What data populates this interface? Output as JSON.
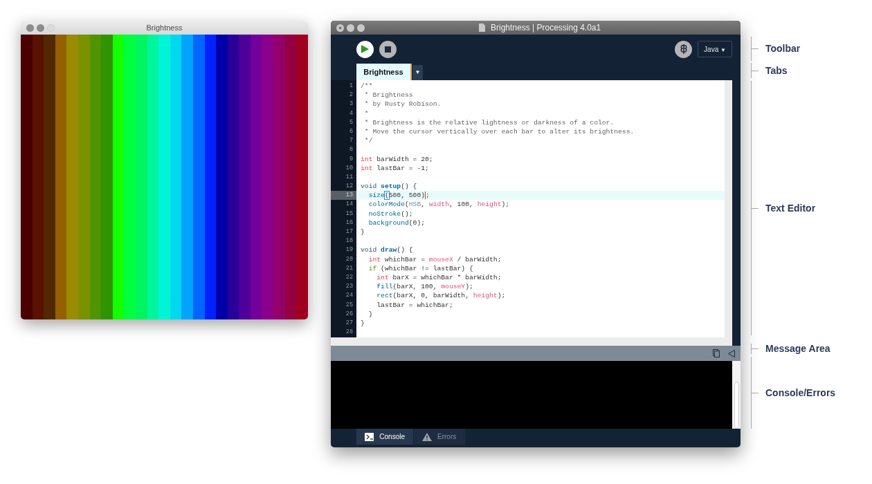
{
  "sketch_window": {
    "title": "Brightness",
    "bars": [
      {
        "color": "#4a0000"
      },
      {
        "color": "#571200"
      },
      {
        "color": "#522800"
      },
      {
        "color": "#946000"
      },
      {
        "color": "#998c00"
      },
      {
        "color": "#7a9100"
      },
      {
        "color": "#509400"
      },
      {
        "color": "#2f9400"
      },
      {
        "color": "#14ff00"
      },
      {
        "color": "#00ff40"
      },
      {
        "color": "#00f560"
      },
      {
        "color": "#00f5a0"
      },
      {
        "color": "#00f5d8"
      },
      {
        "color": "#00d8f0"
      },
      {
        "color": "#00a4ff"
      },
      {
        "color": "#0066ff"
      },
      {
        "color": "#0022ff"
      },
      {
        "color": "#0000a8"
      },
      {
        "color": "#2a0099"
      },
      {
        "color": "#4f0099"
      },
      {
        "color": "#72009a"
      },
      {
        "color": "#8a008a"
      },
      {
        "color": "#94006a"
      },
      {
        "color": "#940040"
      },
      {
        "color": "#a00020"
      }
    ]
  },
  "editor_window": {
    "title": "Brightness | Processing 4.0a1",
    "toolbar": {
      "mode_label": "Java",
      "mode_arrow": "▼"
    },
    "tabs": [
      {
        "label": "Brightness",
        "selected": true
      }
    ],
    "tab_menu": "▼",
    "lines": [
      {
        "number": "1",
        "selected": false,
        "tokens": [
          {
            "kind": "comment",
            "text": "/**"
          }
        ]
      },
      {
        "number": "2",
        "selected": false,
        "tokens": [
          {
            "kind": "comment",
            "text": " * Brightness"
          }
        ]
      },
      {
        "number": "3",
        "selected": false,
        "tokens": [
          {
            "kind": "comment",
            "text": " * by Rusty Robison."
          }
        ]
      },
      {
        "number": "4",
        "selected": false,
        "tokens": [
          {
            "kind": "comment",
            "text": " *"
          }
        ]
      },
      {
        "number": "5",
        "selected": false,
        "tokens": [
          {
            "kind": "comment",
            "text": " * Brightness is the relative lightness or darkness of a color."
          }
        ]
      },
      {
        "number": "6",
        "selected": false,
        "tokens": [
          {
            "kind": "comment",
            "text": " * Move the cursor vertically over each bar to alter its brightness."
          }
        ]
      },
      {
        "number": "7",
        "selected": false,
        "tokens": [
          {
            "kind": "comment",
            "text": " */"
          }
        ]
      },
      {
        "number": "8",
        "selected": false
      },
      {
        "number": "9",
        "selected": false,
        "tokens": [
          {
            "kind": "type",
            "text": "int"
          },
          {
            "kind": "plain",
            "text": " barWidth = 20;"
          }
        ]
      },
      {
        "number": "10",
        "selected": false,
        "tokens": [
          {
            "kind": "type",
            "text": "int"
          },
          {
            "kind": "plain",
            "text": " lastBar = -1;"
          }
        ]
      },
      {
        "number": "11",
        "selected": false
      },
      {
        "number": "12",
        "selected": false,
        "tokens": [
          {
            "kind": "keyword",
            "text": "void "
          },
          {
            "kind": "definition",
            "text": "setup"
          },
          {
            "kind": "plain",
            "text": "() {"
          }
        ]
      },
      {
        "number": "13",
        "selected": true,
        "tokens": [
          {
            "kind": "function",
            "text": "  size"
          },
          {
            "kind": "match",
            "text": "("
          },
          {
            "kind": "plain",
            "text": "500, 500)"
          },
          {
            "kind": "caret"
          },
          {
            "kind": "plain",
            "text": ";"
          }
        ]
      },
      {
        "number": "14",
        "selected": false,
        "tokens": [
          {
            "kind": "function",
            "text": "  colorMode"
          },
          {
            "kind": "plain",
            "text": "("
          },
          {
            "kind": "literal",
            "text": "HSB"
          },
          {
            "kind": "plain",
            "text": ", "
          },
          {
            "kind": "constant",
            "text": "width"
          },
          {
            "kind": "plain",
            "text": ", 100, "
          },
          {
            "kind": "constant",
            "text": "height"
          },
          {
            "kind": "plain",
            "text": ");"
          }
        ]
      },
      {
        "number": "15",
        "selected": false,
        "tokens": [
          {
            "kind": "function",
            "text": "  noStroke"
          },
          {
            "kind": "plain",
            "text": "();"
          }
        ]
      },
      {
        "number": "16",
        "selected": false,
        "tokens": [
          {
            "kind": "function",
            "text": "  background"
          },
          {
            "kind": "plain",
            "text": "(0);"
          }
        ]
      },
      {
        "number": "17",
        "selected": false,
        "tokens": [
          {
            "kind": "plain",
            "text": "}"
          }
        ]
      },
      {
        "number": "18",
        "selected": false
      },
      {
        "number": "19",
        "selected": false,
        "tokens": [
          {
            "kind": "keyword",
            "text": "void "
          },
          {
            "kind": "definition",
            "text": "draw"
          },
          {
            "kind": "plain",
            "text": "() {"
          }
        ]
      },
      {
        "number": "20",
        "selected": false,
        "tokens": [
          {
            "kind": "type",
            "text": "  int"
          },
          {
            "kind": "plain",
            "text": " whichBar = "
          },
          {
            "kind": "constant",
            "text": "mouseX"
          },
          {
            "kind": "plain",
            "text": " / barWidth;"
          }
        ]
      },
      {
        "number": "21",
        "selected": false,
        "tokens": [
          {
            "kind": "control",
            "text": "  if"
          },
          {
            "kind": "plain",
            "text": " (whichBar != lastBar) {"
          }
        ]
      },
      {
        "number": "22",
        "selected": false,
        "tokens": [
          {
            "kind": "type",
            "text": "    int"
          },
          {
            "kind": "plain",
            "text": " barX = whichBar * barWidth;"
          }
        ]
      },
      {
        "number": "23",
        "selected": false,
        "tokens": [
          {
            "kind": "function",
            "text": "    fill"
          },
          {
            "kind": "plain",
            "text": "(barX, 100, "
          },
          {
            "kind": "constant",
            "text": "mouseY"
          },
          {
            "kind": "plain",
            "text": ");"
          }
        ]
      },
      {
        "number": "24",
        "selected": false,
        "tokens": [
          {
            "kind": "function",
            "text": "    rect"
          },
          {
            "kind": "plain",
            "text": "(barX, 0, barWidth, "
          },
          {
            "kind": "constant",
            "text": "height"
          },
          {
            "kind": "plain",
            "text": ");"
          }
        ]
      },
      {
        "number": "25",
        "selected": false,
        "tokens": [
          {
            "kind": "plain",
            "text": "    lastBar = whichBar;"
          }
        ]
      },
      {
        "number": "26",
        "selected": false,
        "tokens": [
          {
            "kind": "plain",
            "text": "  }"
          }
        ]
      },
      {
        "number": "27",
        "selected": false,
        "tokens": [
          {
            "kind": "plain",
            "text": "}"
          }
        ]
      },
      {
        "number": "28",
        "selected": false
      }
    ],
    "console_tabs": [
      {
        "label": "Console",
        "kind": "console",
        "selected": true
      },
      {
        "label": "Errors",
        "kind": "errors",
        "selected": false
      }
    ]
  },
  "annotations": [
    {
      "label": "Toolbar",
      "kind": "toolbar"
    },
    {
      "label": "Tabs",
      "kind": "tabs"
    },
    {
      "label": "Text Editor",
      "kind": "editor"
    },
    {
      "label": "Message Area",
      "kind": "message"
    },
    {
      "label": "Console/Errors",
      "kind": "console"
    }
  ]
}
